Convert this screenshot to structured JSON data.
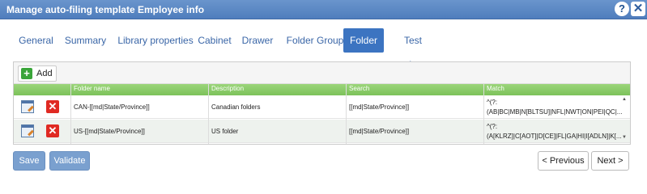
{
  "window": {
    "title": "Manage auto-filing template Employee info",
    "help_icon": "?",
    "close_icon": "✕"
  },
  "tabs": [
    {
      "label": "General"
    },
    {
      "label": "Summary"
    },
    {
      "label": "Library properties"
    },
    {
      "label": "Cabinet"
    },
    {
      "label": "Drawer"
    },
    {
      "label": "Folder Group"
    },
    {
      "label": "Folder",
      "active": true
    },
    {
      "label": "Test values"
    }
  ],
  "grid": {
    "add_label": "Add",
    "columns": [
      "Folder name",
      "Description",
      "Search",
      "Match"
    ],
    "rows": [
      {
        "folder_name": "CAN-[[md|State/Province]]",
        "description": "Canadian folders",
        "search": "[[md|State/Province]]",
        "match_line1": "^(?:",
        "match_line2": "(AB|BC|MB|N[BLTSU]|NFL|NWT|ON|PEI|QC|..."
      },
      {
        "folder_name": "US-[[md|State/Province]]",
        "description": "US folder",
        "search": "[[md|State/Province]]",
        "match_line1": "^(?:",
        "match_line2": "(A[KLRZ]|C[AOT]|D[CE]|FL|GA|HI|I[ADLN]|K[..."
      }
    ]
  },
  "footer": {
    "save": "Save",
    "validate": "Validate",
    "previous": "< Previous",
    "next": "Next >"
  },
  "icons": {
    "edit": "edit-icon",
    "delete": "delete-icon",
    "add": "add-icon"
  },
  "colors": {
    "accent": "#3c74c1",
    "header_green": "#7cc25a",
    "delete_red": "#e02a23"
  }
}
